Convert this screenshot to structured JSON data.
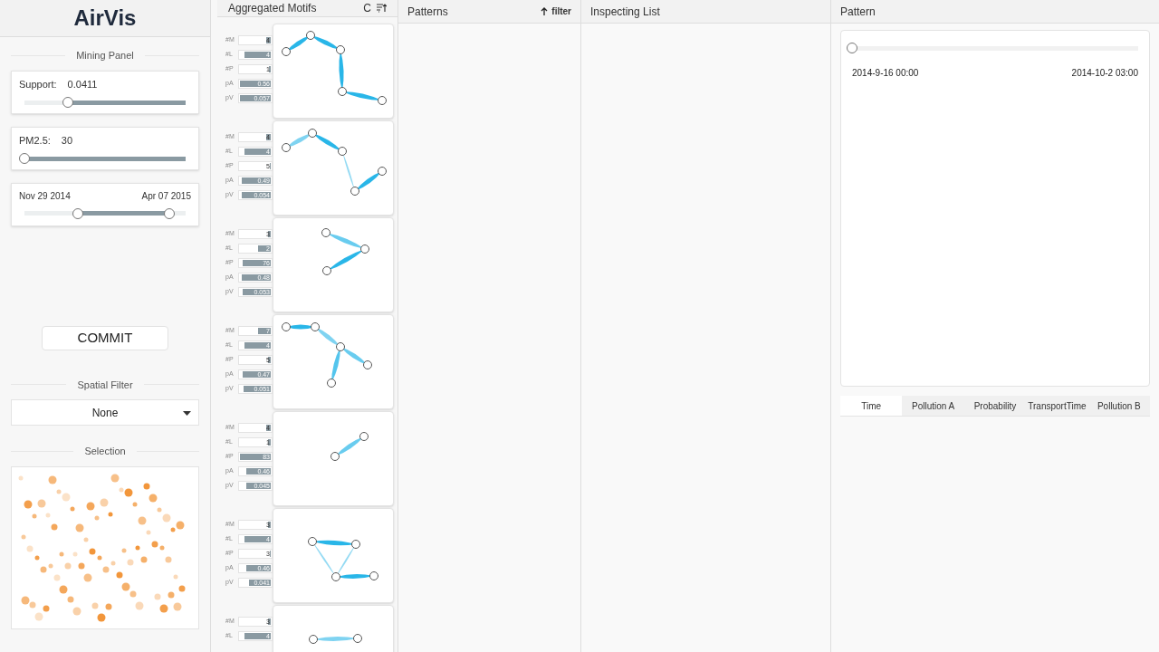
{
  "app": {
    "title": "AirVis"
  },
  "mining_panel": {
    "title": "Mining Panel",
    "support": {
      "label": "Support:",
      "value": "0.0411",
      "level": 0.27
    },
    "pm25": {
      "label": "PM2.5:",
      "value": "30",
      "level": 0
    },
    "date_range": {
      "start_label": "Nov 29 2014",
      "end_label": "Apr 07 2015",
      "start": {
        "level": 0.33
      },
      "end": {
        "level": 0.9
      }
    },
    "commit_button": "COMMIT"
  },
  "spatial_filter": {
    "title": "Spatial Filter",
    "value": "None"
  },
  "selection": {
    "title": "Selection"
  },
  "aggregated_motifs": {
    "title": "Aggregated Motifs",
    "sort_label": "C",
    "cards": [
      {
        "metrics": [
          {
            "label": "#M",
            "value": "4",
            "level": 0.15
          },
          {
            "label": "#L",
            "value": "4",
            "level": 0.85
          },
          {
            "label": "#P",
            "value": "1",
            "level": 0.05
          },
          {
            "label": "pA",
            "value": "0.56",
            "level": 1
          },
          {
            "label": "pV",
            "value": "0.057",
            "level": 1
          }
        ]
      },
      {
        "metrics": [
          {
            "label": "#M",
            "value": "4",
            "level": 0.15
          },
          {
            "label": "#L",
            "value": "4",
            "level": 0.85
          },
          {
            "label": "#P",
            "value": "5",
            "level": 0.03
          },
          {
            "label": "pA",
            "value": "0.49",
            "level": 0.95
          },
          {
            "label": "pV",
            "value": "0.054",
            "level": 0.93
          }
        ]
      },
      {
        "metrics": [
          {
            "label": "#M",
            "value": "3",
            "level": 0.1
          },
          {
            "label": "#L",
            "value": "2",
            "level": 0.4
          },
          {
            "label": "#P",
            "value": "76",
            "level": 0.92
          },
          {
            "label": "pA",
            "value": "0.48",
            "level": 0.93
          },
          {
            "label": "pV",
            "value": "0.053",
            "level": 0.9
          }
        ]
      },
      {
        "metrics": [
          {
            "label": "#M",
            "value": "7",
            "level": 0.4
          },
          {
            "label": "#L",
            "value": "4",
            "level": 0.85
          },
          {
            "label": "#P",
            "value": "5",
            "level": 0.08
          },
          {
            "label": "pA",
            "value": "0.47",
            "level": 0.9
          },
          {
            "label": "pV",
            "value": "0.051",
            "level": 0.88
          }
        ]
      },
      {
        "metrics": [
          {
            "label": "#M",
            "value": "4",
            "level": 0.15
          },
          {
            "label": "#L",
            "value": "1",
            "level": 0.1
          },
          {
            "label": "#P",
            "value": "83",
            "level": 1
          },
          {
            "label": "pA",
            "value": "0.46",
            "level": 0.8
          },
          {
            "label": "pV",
            "value": "0.045",
            "level": 0.8
          }
        ]
      },
      {
        "metrics": [
          {
            "label": "#M",
            "value": "3",
            "level": 0.1
          },
          {
            "label": "#L",
            "value": "4",
            "level": 0.85
          },
          {
            "label": "#P",
            "value": "3",
            "level": 0.03
          },
          {
            "label": "pA",
            "value": "0.46",
            "level": 0.8
          },
          {
            "label": "pV",
            "value": "0.041",
            "level": 0.72
          }
        ]
      },
      {
        "metrics": [
          {
            "label": "#M",
            "value": "3",
            "level": 0.1
          },
          {
            "label": "#L",
            "value": "4",
            "level": 0.85
          }
        ]
      }
    ]
  },
  "patterns": {
    "title": "Patterns",
    "filter_label": "filter"
  },
  "inspecting_list": {
    "title": "Inspecting List"
  },
  "pattern": {
    "title": "Pattern",
    "timeline": {
      "level": 0,
      "start_label": "2014-9-16 00:00",
      "end_label": "2014-10-2 03:00"
    },
    "tabs": [
      {
        "label": "Time",
        "selected": true
      },
      {
        "label": "Pollution A",
        "selected": false
      },
      {
        "label": "Probability",
        "selected": false
      },
      {
        "label": "TransportTime",
        "selected": false
      },
      {
        "label": "Pollution B",
        "selected": false
      }
    ]
  }
}
